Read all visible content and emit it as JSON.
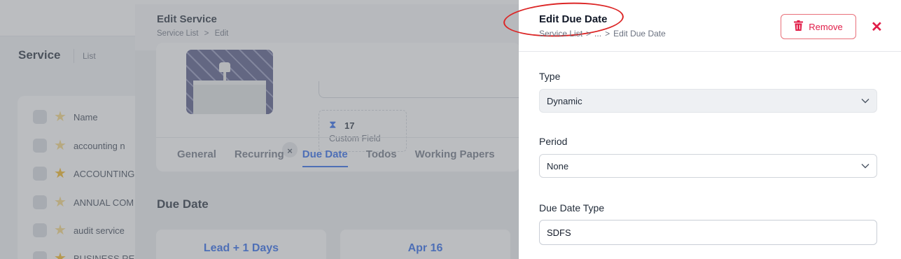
{
  "background": {
    "title": "Service",
    "subtitle": "List",
    "list_items": [
      {
        "label": "Name",
        "starred": false
      },
      {
        "label": "accounting n",
        "starred": false
      },
      {
        "label": "ACCOUNTING",
        "starred": true
      },
      {
        "label": "ANNUAL COM",
        "starred": false
      },
      {
        "label": "audit service",
        "starred": false
      },
      {
        "label": "BUSINESS RES",
        "starred": true
      }
    ]
  },
  "service_panel": {
    "title": "Edit Service",
    "breadcrumb": {
      "root": "Service List",
      "sep": ">",
      "current": "Edit"
    },
    "custom_field": {
      "count": "17",
      "label": "Custom Field"
    },
    "tabs": [
      "General",
      "Recurring",
      "Due Date",
      "Todos",
      "Working Papers"
    ],
    "active_tab": "Due Date",
    "section_title": "Due Date",
    "cards": [
      "Lead + 1 Days",
      "Apr 16"
    ]
  },
  "drawer": {
    "title": "Edit Due Date",
    "breadcrumb": {
      "root": "Service List",
      "sep1": ">",
      "middle": "...",
      "sep2": ">",
      "current": "Edit Due Date"
    },
    "remove_label": "Remove",
    "close_glyph": "✕",
    "fields": {
      "type": {
        "label": "Type",
        "value": "Dynamic"
      },
      "period": {
        "label": "Period",
        "value": "None"
      },
      "due_date_type": {
        "label": "Due Date Type",
        "value": "SDFS"
      }
    }
  },
  "colors": {
    "accent": "#2563eb",
    "danger": "#e11d48",
    "annotation": "#dc2626"
  },
  "icons": {
    "remove": "trash-icon",
    "close": "close-icon",
    "dropdown": "chevron-down-icon",
    "custom_field": "hourglass-icon",
    "favorite": "star-icon"
  }
}
